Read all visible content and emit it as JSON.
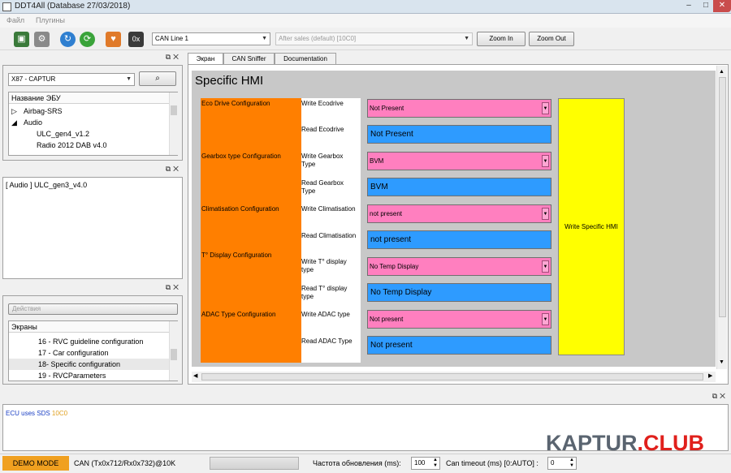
{
  "window": {
    "title": "DDT4All (Database 27/03/2018)"
  },
  "menu": {
    "file": "Файл",
    "plugins": "Плугины"
  },
  "toolbar": {
    "hex_label": "0x",
    "can_line": "CAN Line 1",
    "session": "After sales (default) [10C0]",
    "zoom_in": "Zoom In",
    "zoom_out": "Zoom Out"
  },
  "ecu_panel": {
    "selected": "X87 - CAPTUR",
    "tree_header": "Название ЭБУ",
    "items": [
      "Airbag-SRS",
      "Audio",
      "ULC_gen4_v1.2",
      "Radio 2012 DAB v4.0"
    ]
  },
  "selected_panel": {
    "text": "[ Audio ] ULC_gen3_v4.0"
  },
  "screens_panel": {
    "actions": "Действия",
    "header": "Экраны",
    "items": [
      "16 - RVC guideline configuration",
      "17 - Car configuration",
      "18- Specific configuration",
      "19 - RVCParameters"
    ]
  },
  "tabs": [
    "Экран",
    "CAN Sniffer",
    "Documentation"
  ],
  "screen": {
    "title": "Specific HMI",
    "groups": [
      "Eco Drive Configuration",
      "Gearbox type Configuration",
      "Climatisation Configuration",
      "T° Display Configuration",
      "ADAC Type Configuration"
    ],
    "rows": [
      {
        "label": "Write Ecodrive",
        "value": "Not Present"
      },
      {
        "label": "Read Ecodrive",
        "value": "Not Present"
      },
      {
        "label": "Write Gearbox Type",
        "value": "BVM"
      },
      {
        "label": "Read Gearbox Type",
        "value": "BVM"
      },
      {
        "label": "Write Climatisation",
        "value": "not present"
      },
      {
        "label": "Read Climatisation",
        "value": "not present"
      },
      {
        "label": "Write T° display type",
        "value": "No Temp Display"
      },
      {
        "label": "Read T° display type",
        "value": "No Temp Display"
      },
      {
        "label": "Write ADAC type",
        "value": "Not present"
      },
      {
        "label": "Read ADAC Type",
        "value": "Not present"
      }
    ],
    "write_button": "Write Specific HMI"
  },
  "log": {
    "prefix": "ECU uses SDS",
    "code": "10C0"
  },
  "status": {
    "demo": "DEMO MODE",
    "can": "CAN (Tx0x712/Rx0x732)@10K",
    "refresh_label": "Частота обновления (ms):",
    "refresh_value": "100",
    "timeout_label": "Can timeout (ms) [0:AUTO] :",
    "timeout_value": "0"
  },
  "watermark": {
    "part1": "KAPTUR",
    "part2": ".CLUB"
  },
  "colors": {
    "orange": "#ff7f00",
    "pink": "#ff7fbf",
    "blue": "#2e9bff",
    "yellow": "#ffff00",
    "demo": "#f0a020"
  }
}
